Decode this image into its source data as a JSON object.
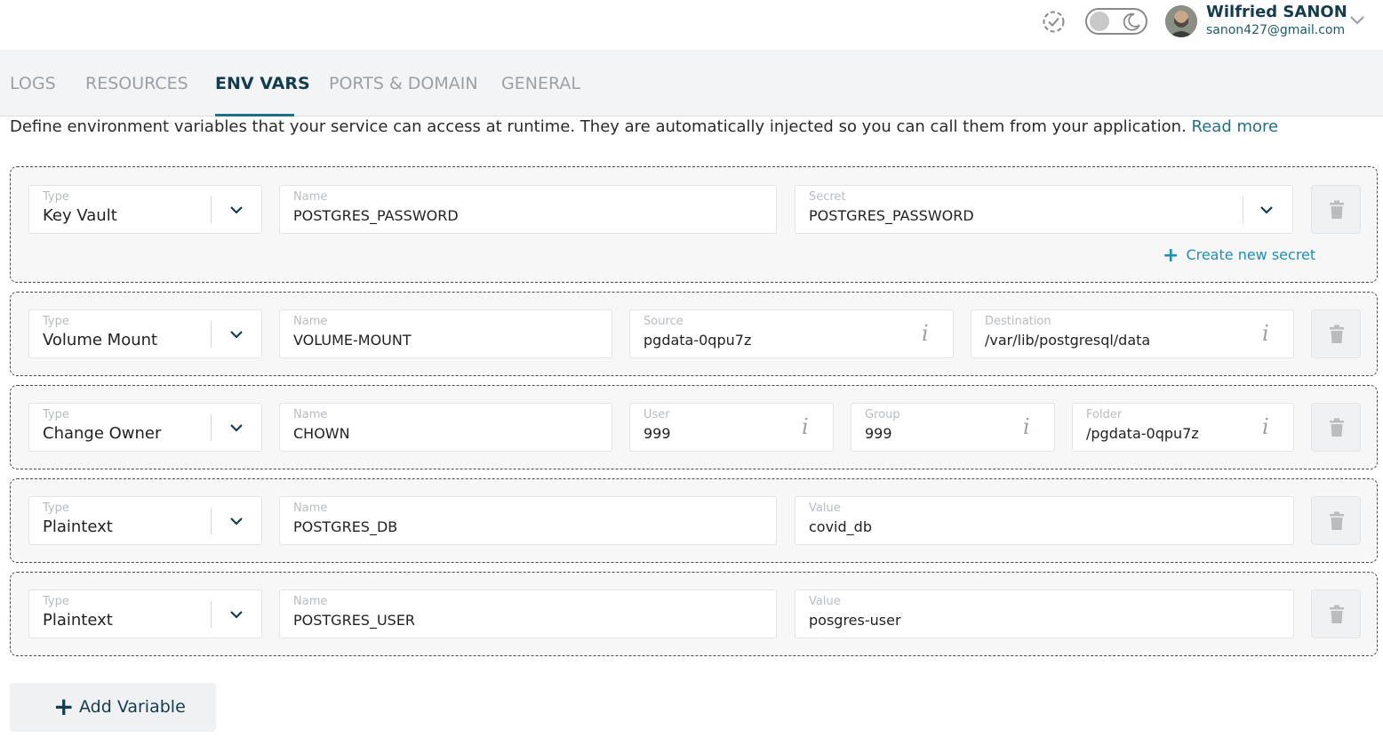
{
  "header": {
    "status_icon": "check-circle-icon",
    "theme_toggle": {
      "mode": "light",
      "icon": "moon-icon"
    },
    "user": {
      "name": "Wilfried SANON",
      "email": "sanon427@gmail.com"
    }
  },
  "tabs": [
    {
      "label": "LOGS",
      "active": false
    },
    {
      "label": "RESOURCES",
      "active": false
    },
    {
      "label": "ENV VARS",
      "active": true
    },
    {
      "label": "PORTS & DOMAIN",
      "active": false
    },
    {
      "label": "GENERAL",
      "active": false
    }
  ],
  "intro": {
    "text": "Define environment variables that your service can access at runtime. They are automatically injected so you can call them from your application.",
    "link": "Read more"
  },
  "variables": [
    {
      "type_label": "Type",
      "type": "Key Vault",
      "name_label": "Name",
      "name": "POSTGRES_PASSWORD",
      "secret_label": "Secret",
      "secret": "POSTGRES_PASSWORD",
      "create_secret": "Create new secret"
    },
    {
      "type_label": "Type",
      "type": "Volume Mount",
      "name_label": "Name",
      "name": "VOLUME-MOUNT",
      "source_label": "Source",
      "source": "pgdata-0qpu7z",
      "destination_label": "Destination",
      "destination": "/var/lib/postgresql/data"
    },
    {
      "type_label": "Type",
      "type": "Change Owner",
      "name_label": "Name",
      "name": "CHOWN",
      "user_label": "User",
      "user": "999",
      "group_label": "Group",
      "group": "999",
      "folder_label": "Folder",
      "folder": "/pgdata-0qpu7z"
    },
    {
      "type_label": "Type",
      "type": "Plaintext",
      "name_label": "Name",
      "name": "POSTGRES_DB",
      "value_label": "Value",
      "value": "covid_db"
    },
    {
      "type_label": "Type",
      "type": "Plaintext",
      "name_label": "Name",
      "name": "POSTGRES_USER",
      "value_label": "Value",
      "value": "posgres-user"
    }
  ],
  "info_glyph": "i",
  "add_button": {
    "icon": "plus-icon",
    "label": "Add Variable"
  },
  "colors": {
    "brand_dark": "#133d4f",
    "accent": "#1f6f85",
    "link": "#1f8fb0",
    "tab_inactive": "#9aa1a6"
  }
}
